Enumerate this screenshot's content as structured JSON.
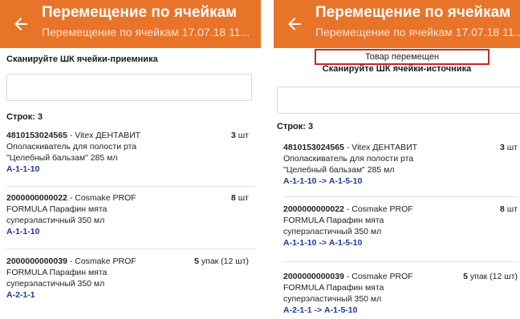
{
  "left": {
    "header": {
      "title": "Перемещение по ячейкам",
      "subtitle": "Перемещение по ячейкам 17.07.18 11..."
    },
    "prompt": "Сканируйте ШК ячейки-приемника",
    "input": {
      "value": "",
      "placeholder": ""
    },
    "rows_count": "Строк: 3",
    "items": [
      {
        "code": "4810153024565",
        "name": " - Vitex ДЕНТАВИТ Ополаскиватель для полости рта \"Целебный бальзам\" 285 мл",
        "location": "А-1-1-10",
        "qty": "3",
        "qty_unit": " шт"
      },
      {
        "code": "2000000000022",
        "name": " - Cosmake PROF FORMULA Парафин мята суперэластичный 350 мл",
        "location": "А-1-1-10",
        "qty": "8",
        "qty_unit": " шт"
      },
      {
        "code": "2000000000039",
        "name": " - Cosmake PROF FORMULA Парафин мята суперэластичный 350 мл",
        "location": "А-2-1-1",
        "qty": "5",
        "qty_unit": " упак (12 шт)"
      }
    ]
  },
  "right": {
    "header": {
      "title": "Перемещение по ячейкам",
      "subtitle": "Перемещение по ячейкам 17.07.18 11..."
    },
    "toast": "Товар перемещен",
    "prompt": "Сканируйте ШК ячейки-источника",
    "input": {
      "value": "",
      "placeholder": ""
    },
    "rows_count": "Строк: 3",
    "items": [
      {
        "code": "4810153024565",
        "name": " - Vitex ДЕНТАВИТ Ополаскиватель для полости рта \"Целебный бальзам\" 285 мл",
        "location": "А-1-1-10 -> А-1-5-10",
        "qty": "3",
        "qty_unit": " шт"
      },
      {
        "code": "2000000000022",
        "name": " - Cosmake PROF FORMULA Парафин мята суперэластичный 350 мл",
        "location": "А-1-1-10 -> А-1-5-10",
        "qty": "8",
        "qty_unit": " шт"
      },
      {
        "code": "2000000000039",
        "name": " - Cosmake PROF FORMULA Парафин мята суперэластичный 350 мл",
        "location": "А-2-1-1 -> А-1-5-10",
        "qty": "5",
        "qty_unit": " упак (12 шт)"
      }
    ]
  },
  "icons": {
    "back": "arrow-left-icon"
  },
  "colors": {
    "appbar": "#e8742a",
    "location_text": "#1f3a93",
    "toast_border": "#c62828"
  }
}
